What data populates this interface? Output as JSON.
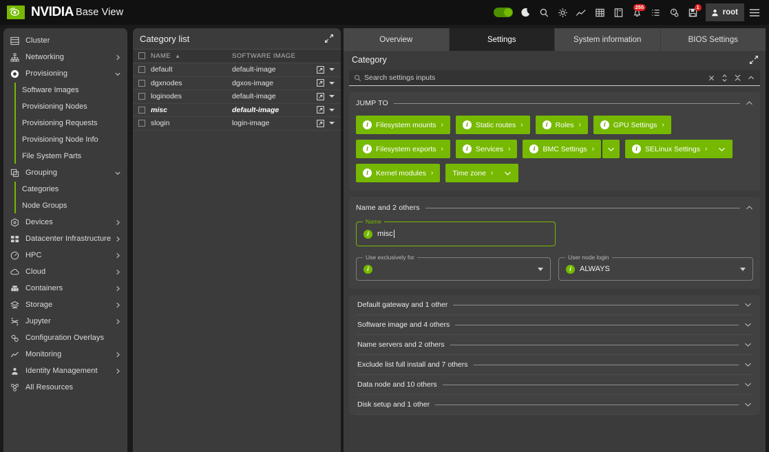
{
  "topbar": {
    "brand": "NVIDIA",
    "app_title": "Base View",
    "icons": [
      {
        "name": "theme-toggle",
        "label": "theme-toggle"
      },
      {
        "name": "dark-mode-icon",
        "label": "moon-icon"
      },
      {
        "name": "search-icon",
        "label": "search-icon"
      },
      {
        "name": "settings-gear-icon",
        "label": "gear-icon"
      },
      {
        "name": "monitoring-chart-icon",
        "label": "chart-icon"
      },
      {
        "name": "grid-icon",
        "label": "grid-icon"
      },
      {
        "name": "book-icon",
        "label": "book-icon"
      },
      {
        "name": "notifications-bell-icon",
        "label": "bell-icon",
        "badge": "255"
      },
      {
        "name": "task-list-icon",
        "label": "list-icon"
      },
      {
        "name": "scheduler-icon",
        "label": "clock-gear-icon"
      },
      {
        "name": "save-icon",
        "label": "floppy-icon",
        "badge": "1"
      }
    ],
    "user": "root",
    "menu_icon": "hamburger-icon"
  },
  "sidebar": {
    "items": [
      {
        "label": "Cluster",
        "icon": "cluster-icon",
        "chevron": "none"
      },
      {
        "label": "Networking",
        "icon": "network-icon",
        "chevron": "right"
      },
      {
        "label": "Provisioning",
        "icon": "provisioning-icon",
        "chevron": "down",
        "active": true
      }
    ],
    "provisioning_children": [
      {
        "label": "Software Images"
      },
      {
        "label": "Provisioning Nodes"
      },
      {
        "label": "Provisioning Requests"
      },
      {
        "label": "Provisioning Node Info"
      },
      {
        "label": "File System Parts"
      }
    ],
    "grouping": {
      "label": "Grouping",
      "icon": "grouping-icon",
      "chevron": "down"
    },
    "grouping_children": [
      {
        "label": "Categories"
      },
      {
        "label": "Node Groups"
      }
    ],
    "items_bottom": [
      {
        "label": "Devices",
        "icon": "devices-icon",
        "chevron": "right"
      },
      {
        "label": "Datacenter Infrastructure",
        "icon": "datacenter-icon",
        "chevron": "right"
      },
      {
        "label": "HPC",
        "icon": "hpc-icon",
        "chevron": "right"
      },
      {
        "label": "Cloud",
        "icon": "cloud-icon",
        "chevron": "right"
      },
      {
        "label": "Containers",
        "icon": "containers-icon",
        "chevron": "right"
      },
      {
        "label": "Storage",
        "icon": "storage-icon",
        "chevron": "right"
      },
      {
        "label": "Jupyter",
        "icon": "jupyter-icon",
        "chevron": "right"
      },
      {
        "label": "Configuration Overlays",
        "icon": "config-overlays-icon",
        "chevron": "none"
      },
      {
        "label": "Monitoring",
        "icon": "monitoring-icon",
        "chevron": "right"
      },
      {
        "label": "Identity Management",
        "icon": "identity-icon",
        "chevron": "right"
      },
      {
        "label": "All Resources",
        "icon": "all-resources-icon",
        "chevron": "none"
      }
    ]
  },
  "category_list": {
    "title": "Category list",
    "columns": [
      "NAME",
      "SOFTWARE IMAGE"
    ],
    "sort_column": "NAME",
    "sort_direction": "asc",
    "rows": [
      {
        "name": "default",
        "software_image": "default-image",
        "selected": false
      },
      {
        "name": "dgxnodes",
        "software_image": "dgxos-image",
        "selected": false
      },
      {
        "name": "loginodes",
        "software_image": "default-image",
        "selected": false
      },
      {
        "name": "misc",
        "software_image": "default-image",
        "selected": true
      },
      {
        "name": "slogin",
        "software_image": "login-image",
        "selected": false
      }
    ]
  },
  "main": {
    "tabs": [
      {
        "label": "Overview",
        "active": false
      },
      {
        "label": "Settings",
        "active": true
      },
      {
        "label": "System information",
        "active": false
      },
      {
        "label": "BIOS Settings",
        "active": false
      }
    ],
    "panel_title": "Category",
    "search": {
      "placeholder": "Search settings inputs",
      "value": ""
    },
    "jump_to": {
      "title": "JUMP TO",
      "chips": [
        {
          "label": "Filesystem mounts",
          "arrow": true,
          "dropdown": "none"
        },
        {
          "label": "Static routes",
          "arrow": true,
          "dropdown": "none"
        },
        {
          "label": "Roles",
          "arrow": true,
          "dropdown": "none"
        },
        {
          "label": "GPU Settings",
          "arrow": true,
          "dropdown": "none"
        },
        {
          "label": "Filesystem exports",
          "arrow": true,
          "dropdown": "none"
        },
        {
          "label": "Services",
          "arrow": true,
          "dropdown": "none"
        },
        {
          "label": "BMC Settings",
          "arrow": true,
          "dropdown": "split"
        },
        {
          "label": "SELinux Settings",
          "arrow": true,
          "dropdown": "inline"
        },
        {
          "label": "Kernel modules",
          "arrow": true,
          "dropdown": "none"
        },
        {
          "label": "Time zone",
          "arrow": true,
          "dropdown": "inline"
        }
      ]
    },
    "name_section": {
      "title": "Name and 2 others",
      "name_field": {
        "legend": "Name",
        "value": "misc"
      },
      "use_exclusively": {
        "legend": "Use exclusively for",
        "value": ""
      },
      "user_node_login": {
        "legend": "User node login",
        "value": "ALWAYS"
      }
    },
    "accordions": [
      {
        "title": "Default gateway and 1 other"
      },
      {
        "title": "Software image and 4 others"
      },
      {
        "title": "Name servers and 2 others"
      },
      {
        "title": "Exclude list full install and 7 others"
      },
      {
        "title": "Data node and 10 others"
      },
      {
        "title": "Disk setup and 1 other"
      }
    ]
  },
  "colors": {
    "nvidia_green": "#76b900",
    "badge_red": "#e02020",
    "panel_bg": "#3b3b3b",
    "section_bg": "#414141",
    "topbar_bg": "#111112"
  }
}
